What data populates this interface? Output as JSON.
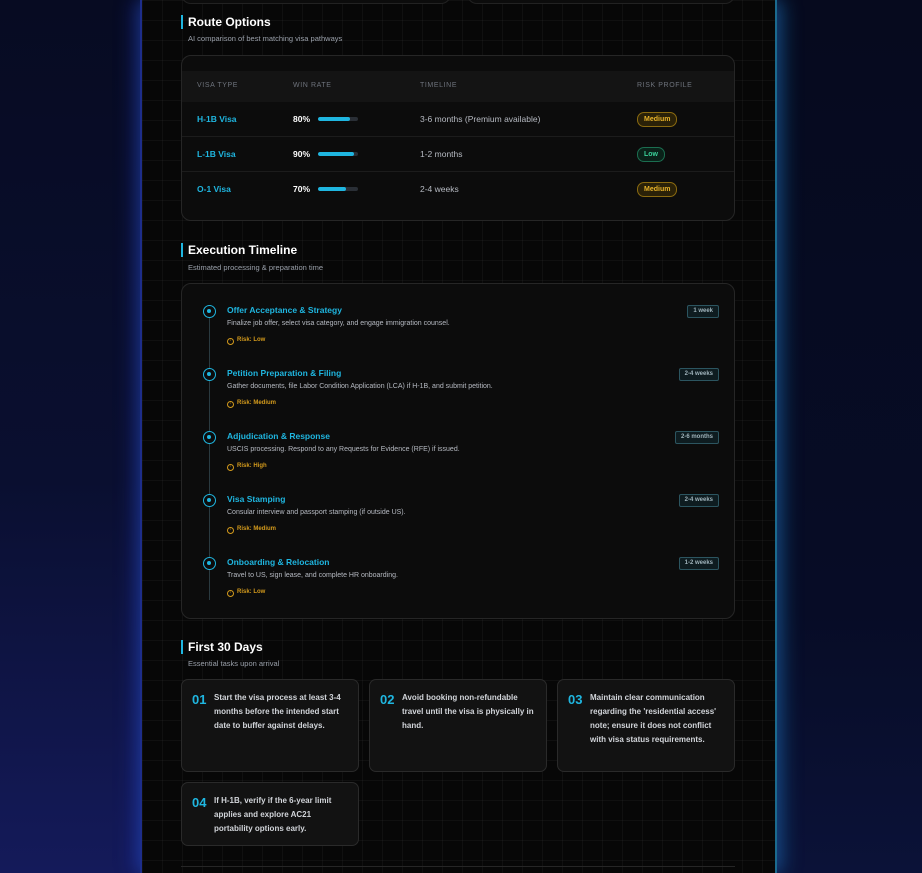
{
  "colors": {
    "accent": "#1fb6e0",
    "medium": "#e8b32a",
    "low": "#3ad29a",
    "panel": "#070707"
  },
  "route_options": {
    "title": "Route Options",
    "subtitle": "AI comparison of best matching visa pathways",
    "columns": [
      "VISA TYPE",
      "WIN RATE",
      "TIMELINE",
      "RISK PROFILE"
    ],
    "rows": [
      {
        "visa": "H-1B Visa",
        "win_rate": "80%",
        "win_value": 0.8,
        "timeline": "3-6 months (Premium available)",
        "risk": "Medium",
        "risk_level": "medium"
      },
      {
        "visa": "L-1B Visa",
        "win_rate": "90%",
        "win_value": 0.9,
        "timeline": "1-2 months",
        "risk": "Low",
        "risk_level": "low"
      },
      {
        "visa": "O-1 Visa",
        "win_rate": "70%",
        "win_value": 0.7,
        "timeline": "2-4 weeks",
        "risk": "Medium",
        "risk_level": "medium"
      }
    ]
  },
  "execution_timeline": {
    "title": "Execution Timeline",
    "subtitle": "Estimated processing & preparation time",
    "steps": [
      {
        "title": "Offer Acceptance & Strategy",
        "desc": "Finalize job offer, select visa category, and engage immigration counsel.",
        "risk": "Risk: Low",
        "duration": "1 week"
      },
      {
        "title": "Petition Preparation & Filing",
        "desc": "Gather documents, file Labor Condition Application (LCA) if H-1B, and submit petition.",
        "risk": "Risk: Medium",
        "duration": "2-4 weeks"
      },
      {
        "title": "Adjudication & Response",
        "desc": "USCIS processing. Respond to any Requests for Evidence (RFE) if issued.",
        "risk": "Risk: High",
        "duration": "2-6 months"
      },
      {
        "title": "Visa Stamping",
        "desc": "Consular interview and passport stamping (if outside US).",
        "risk": "Risk: Medium",
        "duration": "2-4 weeks"
      },
      {
        "title": "Onboarding & Relocation",
        "desc": "Travel to US, sign lease, and complete HR onboarding.",
        "risk": "Risk: Low",
        "duration": "1-2 weeks"
      }
    ]
  },
  "first_30_days": {
    "title": "First 30 Days",
    "subtitle": "Essential tasks upon arrival",
    "tips": [
      {
        "num": "01",
        "text": "Start the visa process at least 3-4 months before the intended start date to buffer against delays."
      },
      {
        "num": "02",
        "text": "Avoid booking non-refundable travel until the visa is physically in hand."
      },
      {
        "num": "03",
        "text": "Maintain clear communication regarding the 'residential access' note; ensure it does not conflict with visa status requirements."
      },
      {
        "num": "04",
        "text": "If H-1B, verify if the 6-year limit applies and explore AC21 portability options early."
      }
    ]
  }
}
